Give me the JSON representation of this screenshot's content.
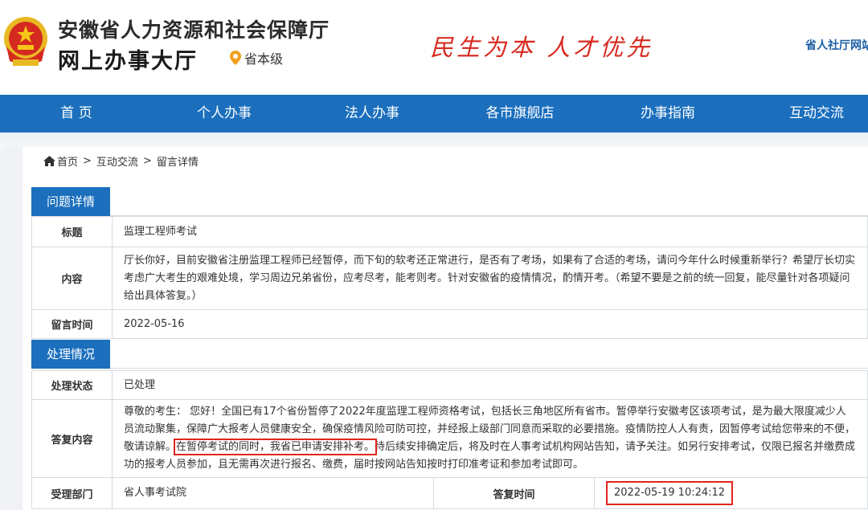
{
  "header": {
    "org_name": "安徽省人力资源和社会保障厅",
    "hall_name": "网上办事大厅",
    "location": "省本级",
    "slogan": "民生为本 人才优先",
    "top_link": "省人社厅网站"
  },
  "nav": {
    "items": [
      "首 页",
      "个人办事",
      "法人办事",
      "各市旗舰店",
      "办事指南",
      "互动交流"
    ]
  },
  "breadcrumb": {
    "home": "首页",
    "sep": ">",
    "level2": "互动交流",
    "level3": "留言详情"
  },
  "question": {
    "section_title": "问题详情",
    "title_label": "标题",
    "title_value": "监理工程师考试",
    "content_label": "内容",
    "content_value": "厅长你好，目前安徽省注册监理工程师已经暂停，而下旬的软考还正常进行，是否有了考场，如果有了合适的考场，请问今年什么时候重新举行？希望厅长切实考虑广大考生的艰难处境，学习周边兄弟省份，应考尽考，能考则考。针对安徽省的疫情情况，酌情开考。（希望不要是之前的统一回复，能尽量针对各项疑问给出具体答复。）",
    "time_label": "留言时间",
    "time_value": "2022-05-16"
  },
  "handling": {
    "section_title": "处理情况",
    "status_label": "处理状态",
    "status_value": "已处理",
    "reply_label": "答复内容",
    "reply_part1": "尊敬的考生： 您好！全国已有17个省份暂停了2022年度监理工程师资格考试，包括长三角地区所有省市。暂停举行安徽考区该项考试，是为最大限度减少人员流动聚集，保障广大报考人员健康安全，确保疫情风险可防可控，并经报上级部门同意而采取的必要措施。疫情防控人人有责，因暂停考试给您带来的不便，敬请谅解。",
    "reply_highlight": "在暂停考试的同时，我省已申请安排补考。",
    "reply_part2": "待后续安排确定后，将及时在人事考试机构网站告知，请予关注。如另行安排考试，仅限已报名并缴费成功的报考人员参加，且无需再次进行报名、缴费，届时按网站告知按时打印准考证和参加考试即可。",
    "dept_label": "受理部门",
    "dept_value": "省人事考试院",
    "reply_time_label": "答复时间",
    "reply_time_value": "2022-05-19 10:24:12"
  },
  "colors": {
    "nav_blue": "#1b6fbd",
    "slogan_red": "#d7281e",
    "highlight_red": "#e0251c"
  }
}
